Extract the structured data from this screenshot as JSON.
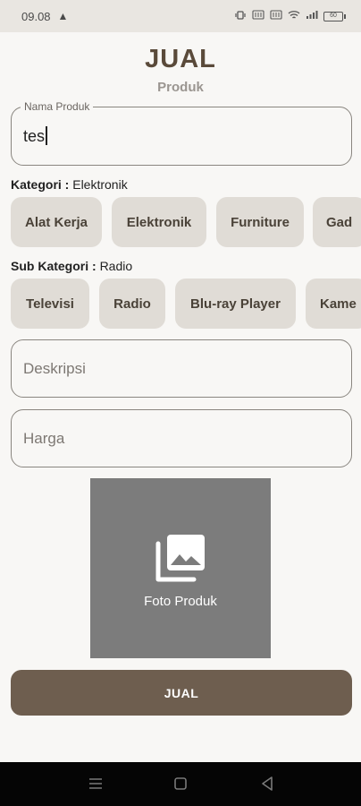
{
  "status_bar": {
    "time": "09.08",
    "warning_icon": "warning-icon",
    "indicators": [
      "vibrate-icon",
      "volte-icon",
      "volte-icon",
      "wifi-icon",
      "signal-icon"
    ],
    "battery": "60"
  },
  "header": {
    "title": "JUAL",
    "subtitle": "Produk"
  },
  "form": {
    "product_name": {
      "label": "Nama Produk",
      "value": "tes"
    },
    "category": {
      "label": "Kategori :",
      "selected": "Elektronik",
      "options": [
        "Alat Kerja",
        "Elektronik",
        "Furniture",
        "Gad"
      ]
    },
    "sub_category": {
      "label": "Sub Kategori :",
      "selected": "Radio",
      "options": [
        "Televisi",
        "Radio",
        "Blu-ray Player",
        "Kame"
      ]
    },
    "description": {
      "placeholder": "Deskripsi"
    },
    "price": {
      "placeholder": "Harga"
    },
    "photo": {
      "label": "Foto Produk",
      "icon": "photo-library-icon"
    },
    "submit_label": "JUAL"
  },
  "nav_bar": {
    "buttons": [
      "menu-icon",
      "home-icon",
      "back-icon"
    ]
  },
  "colors": {
    "accent": "#6e5e4f",
    "title": "#5a4a3a",
    "chip_bg": "#e0dcd6",
    "photo_bg": "#7c7c7c",
    "background": "#f8f7f5"
  }
}
